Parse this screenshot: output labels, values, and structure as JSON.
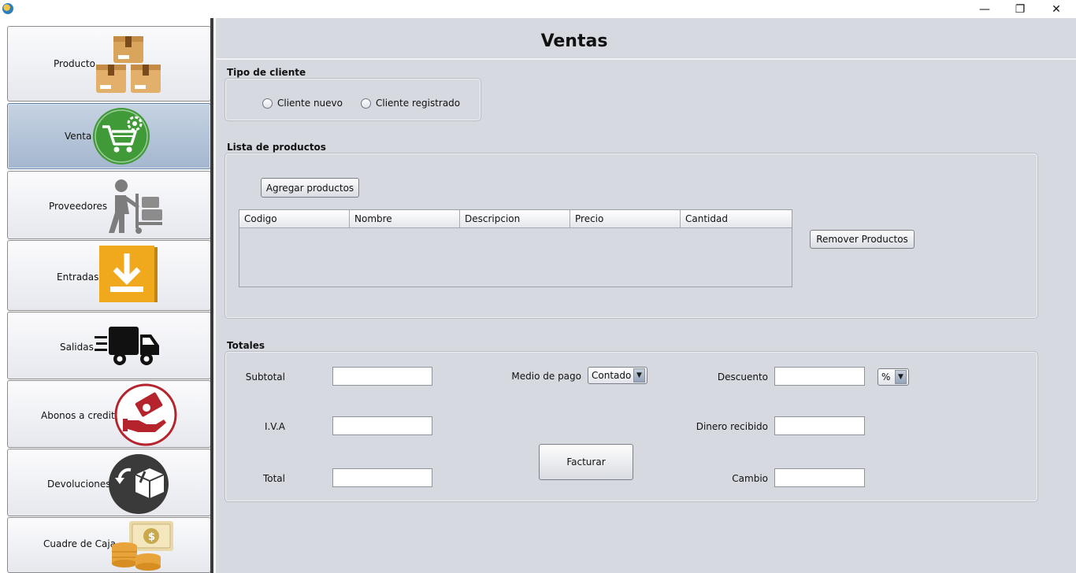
{
  "window": {
    "minimize_glyph": "—",
    "maximize_glyph": "❐",
    "close_glyph": "✕"
  },
  "sidebar": {
    "items": [
      {
        "label": "Producto",
        "icon": "boxes-icon"
      },
      {
        "label": "Venta",
        "icon": "shopping-cart-icon",
        "active": true
      },
      {
        "label": "Proveedores",
        "icon": "delivery-person-icon"
      },
      {
        "label": "Entradas",
        "icon": "download-icon"
      },
      {
        "label": "Salidas",
        "icon": "truck-icon"
      },
      {
        "label": "Abonos a credito",
        "icon": "hand-money-icon"
      },
      {
        "label": "Devoluciones",
        "icon": "box-return-icon"
      },
      {
        "label": "Cuadre de Caja",
        "icon": "cash-coins-icon"
      }
    ]
  },
  "main": {
    "title": "Ventas",
    "tipo_cliente": {
      "label": "Tipo de cliente",
      "options": [
        "Cliente nuevo",
        "Cliente registrado"
      ]
    },
    "lista_productos": {
      "label": "Lista de productos",
      "add_button": "Agregar productos",
      "remove_button": "Remover Productos",
      "columns": [
        "Codigo",
        "Nombre",
        "Descripcion",
        "Precio",
        "Cantidad"
      ]
    },
    "totales": {
      "label": "Totales",
      "subtotal_label": "Subtotal",
      "iva_label": "I.V.A",
      "total_label": "Total",
      "medio_pago_label": "Medio de pago",
      "medio_pago_value": "Contado",
      "descuento_label": "Descuento",
      "descuento_unit": "%",
      "dinero_label": "Dinero recibido",
      "cambio_label": "Cambio",
      "facturar_button": "Facturar"
    }
  },
  "colors": {
    "main_bg": "#d6d9e0",
    "active_nav": "#a4b7ce",
    "cart_green": "#3f9a37",
    "download_orange": "#f0a81d",
    "credit_red": "#b5242d"
  }
}
